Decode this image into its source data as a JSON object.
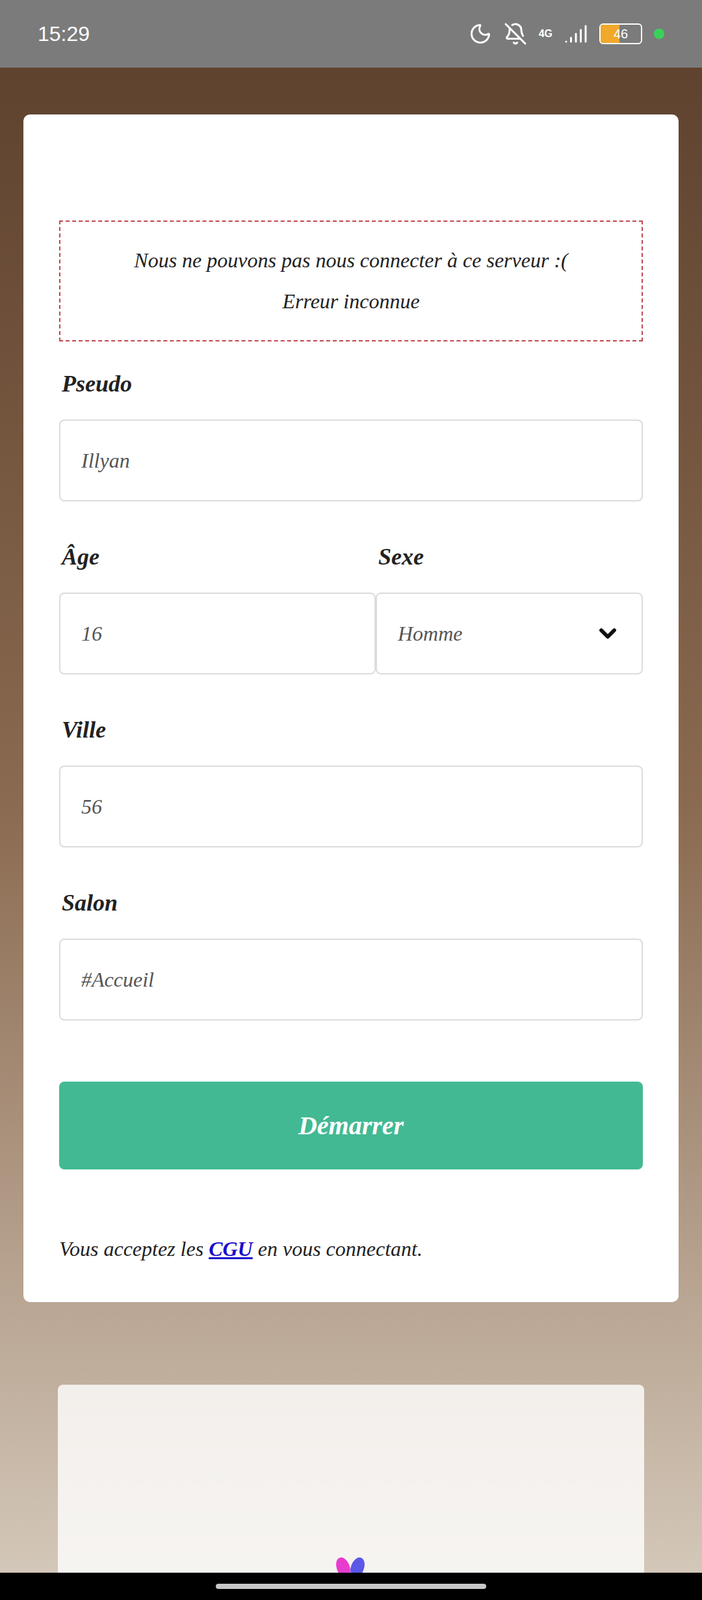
{
  "status_bar": {
    "time": "15:29",
    "network": "4G",
    "battery": {
      "reading": "46",
      "level": 0.46
    }
  },
  "error": {
    "title": "Nous ne pouvons pas nous connecter à ce serveur :(",
    "detail": "Erreur inconnue"
  },
  "fields": [
    {
      "label": "Pseudo",
      "value": "Illyan",
      "kind": "text"
    },
    {
      "label": "Âge",
      "value": "16",
      "kind": "text"
    },
    {
      "label": "Sexe",
      "value": "Homme",
      "kind": "select"
    },
    {
      "label": "Ville",
      "value": "56",
      "kind": "text"
    },
    {
      "label": "Salon",
      "value": "#Accueil",
      "kind": "text"
    }
  ],
  "button": "Démarrer",
  "terms": {
    "before": "Vous acceptez les ",
    "link": "CGU",
    "after": " en vous connectant."
  }
}
